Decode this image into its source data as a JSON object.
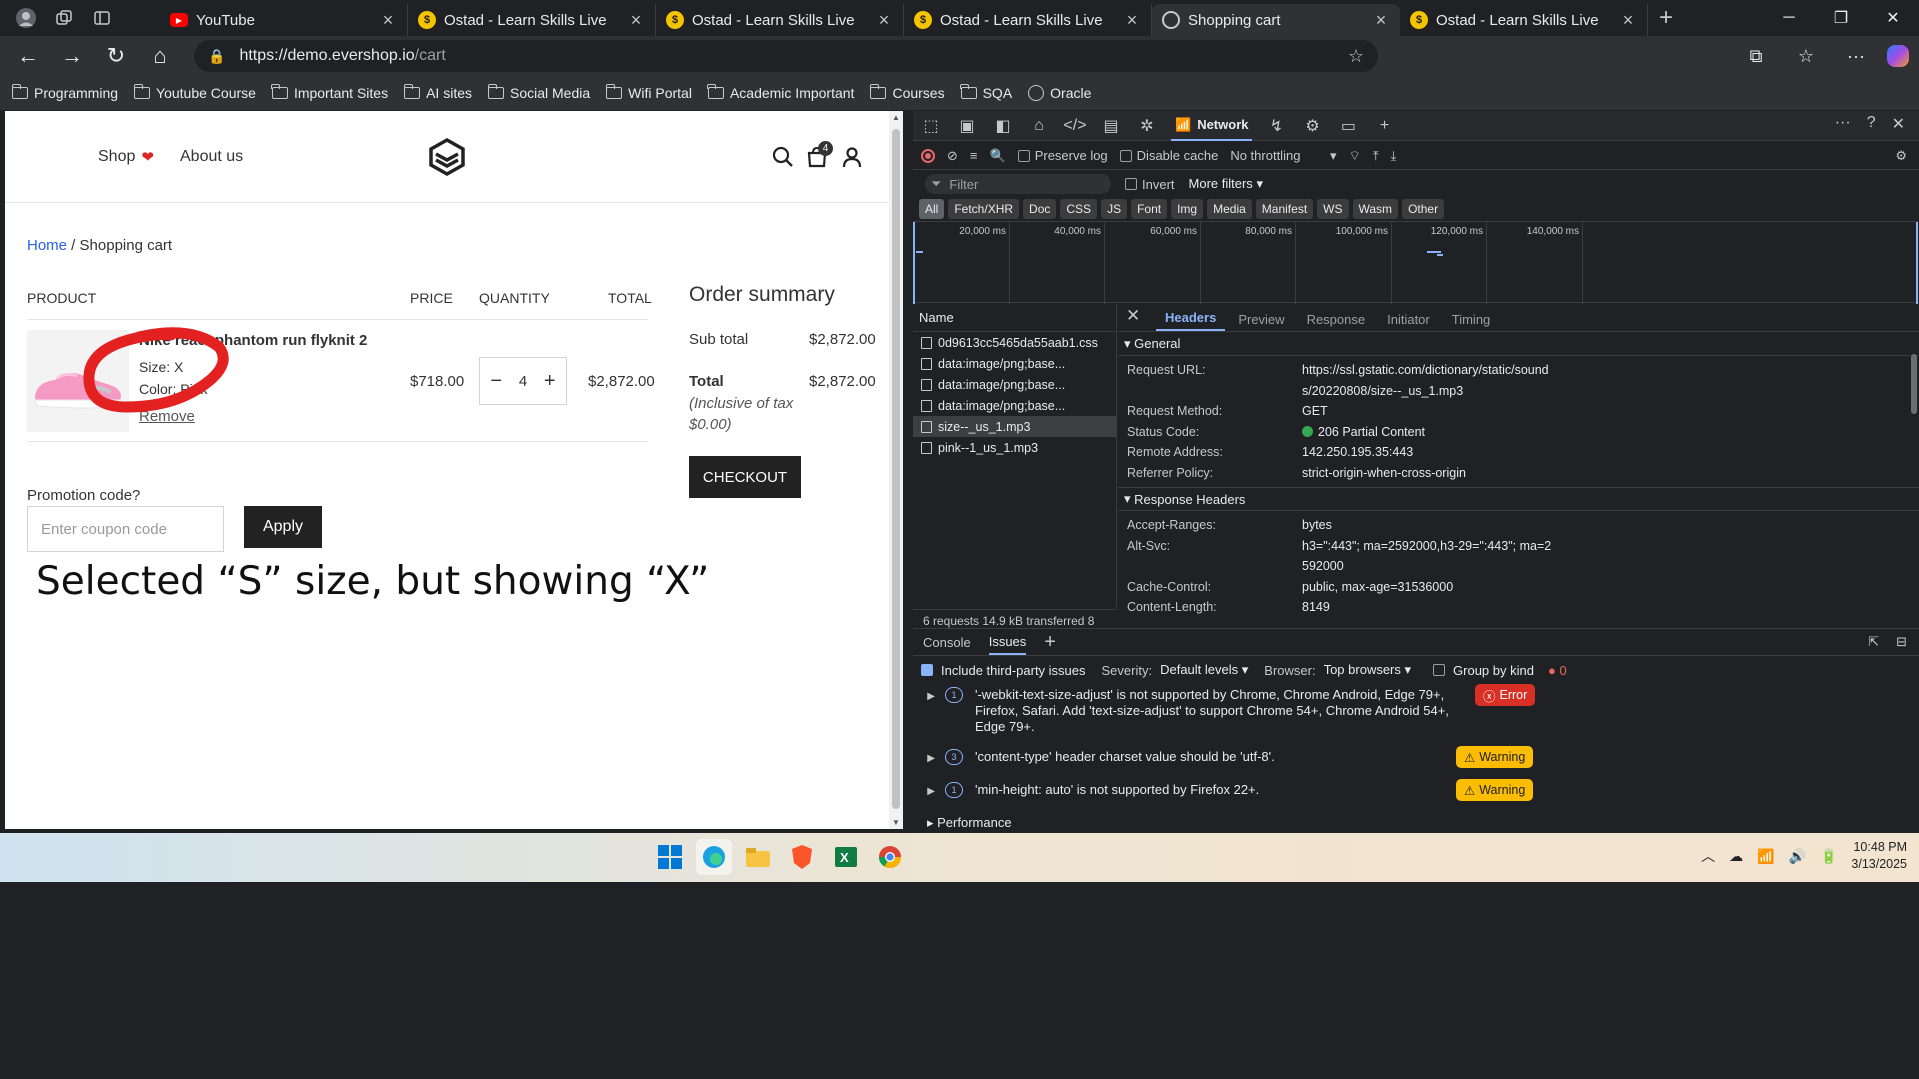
{
  "tabs": [
    {
      "title": "YouTube",
      "favicon": "youtube-icon",
      "active": false
    },
    {
      "title": "Ostad - Learn Skills Live",
      "favicon": "ostad-icon",
      "active": false
    },
    {
      "title": "Ostad - Learn Skills Live",
      "favicon": "ostad-icon",
      "active": false
    },
    {
      "title": "Ostad - Learn Skills Live",
      "favicon": "ostad-icon",
      "active": false
    },
    {
      "title": "Shopping cart",
      "favicon": "globe-icon",
      "active": true
    },
    {
      "title": "Ostad - Learn Skills Live",
      "favicon": "ostad-icon",
      "active": false
    }
  ],
  "address": {
    "host": "https://demo.evershop.io",
    "path": "/cart"
  },
  "bookmarks": [
    "Programming",
    "Youtube Course",
    "Important Sites",
    "AI sites",
    "Social Media",
    "Wifi Portal",
    "Academic Important",
    "Courses",
    "SQA",
    "Oracle"
  ],
  "site": {
    "nav": {
      "shop": "Shop",
      "about": "About us"
    },
    "cart_count": "4",
    "breadcrumb": {
      "home": "Home",
      "sep": " / ",
      "current": "Shopping cart"
    },
    "table_headers": {
      "product": "PRODUCT",
      "price": "PRICE",
      "quantity": "QUANTITY",
      "total": "TOTAL"
    },
    "item": {
      "name": "Nike react phantom run flyknit 2",
      "size": "Size: X",
      "color": "Color: Pink",
      "remove": "Remove",
      "price": "$718.00",
      "quantity": "4",
      "minus": "−",
      "plus": "+",
      "total": "$2,872.00"
    },
    "summary": {
      "title": "Order summary",
      "subtotal_label": "Sub total",
      "subtotal_value": "$2,872.00",
      "total_label": "Total",
      "total_value": "$2,872.00",
      "tax_note": "(Inclusive of tax $0.00)",
      "checkout": "CHECKOUT"
    },
    "promo": {
      "label": "Promotion code?",
      "placeholder": "Enter coupon code",
      "apply": "Apply"
    },
    "annotation": "Selected “S” size, but showing “X”"
  },
  "devtools": {
    "active_panel": "Network",
    "toolbar": {
      "preserve_log": "Preserve log",
      "disable_cache": "Disable cache",
      "throttling": "No throttling"
    },
    "filter": {
      "placeholder": "Filter",
      "invert": "Invert",
      "more_filters": "More filters"
    },
    "type_filters": [
      "All",
      "Fetch/XHR",
      "Doc",
      "CSS",
      "JS",
      "Font",
      "Img",
      "Media",
      "Manifest",
      "WS",
      "Wasm",
      "Other"
    ],
    "timeline_ticks": [
      "20,000 ms",
      "40,000 ms",
      "60,000 ms",
      "80,000 ms",
      "100,000 ms",
      "120,000 ms",
      "140,000 ms"
    ],
    "requests_header": "Name",
    "requests": [
      "0d9613cc5465da55aab1.css",
      "data:image/png;base...",
      "data:image/png;base...",
      "data:image/png;base...",
      "size--_us_1.mp3",
      "pink--1_us_1.mp3"
    ],
    "selected_request": 4,
    "footer": "6 requests   14.9 kB transferred   8",
    "detail_tabs": [
      "Headers",
      "Preview",
      "Response",
      "Initiator",
      "Timing"
    ],
    "general_title": "General",
    "general": [
      {
        "k": "Request URL:",
        "v": "https://ssl.gstatic.com/dictionary/static/sounds/20220808/size--_us_1.mp3"
      },
      {
        "k": "Request Method:",
        "v": "GET"
      },
      {
        "k": "Status Code:",
        "v": "206 Partial Content"
      },
      {
        "k": "Remote Address:",
        "v": "142.250.195.35:443"
      },
      {
        "k": "Referrer Policy:",
        "v": "strict-origin-when-cross-origin"
      }
    ],
    "response_title": "Response Headers",
    "response_headers": [
      {
        "k": "Accept-Ranges:",
        "v": "bytes"
      },
      {
        "k": "Alt-Svc:",
        "v": "h3=\":443\"; ma=2592000,h3-29=\":443\"; ma=2592000"
      },
      {
        "k": "Cache-Control:",
        "v": "public, max-age=31536000"
      },
      {
        "k": "Content-Length:",
        "v": "8149"
      }
    ],
    "drawer_tabs": [
      "Console",
      "Issues"
    ],
    "issues_bar": {
      "third_party": "Include third-party issues",
      "severity": "Severity:",
      "levels": "Default levels",
      "browser": "Browser:",
      "browsers": "Top browsers",
      "group": "Group by kind",
      "count": "0"
    },
    "issues": [
      {
        "count": "1",
        "text": "'-webkit-text-size-adjust' is not supported by Chrome, Chrome Android, Edge 79+, Firefox, Safari. Add 'text-size-adjust' to support Chrome 54+, Chrome Android 54+, Edge 79+.",
        "badge": "Error"
      },
      {
        "count": "3",
        "text": "'content-type' header charset value should be 'utf-8'.",
        "badge": "Warning"
      },
      {
        "count": "1",
        "text": "'min-height: auto' is not supported by Firefox 22+.",
        "badge": "Warning"
      }
    ],
    "perf": "Performance"
  },
  "taskbar": {
    "time": "10:48 PM",
    "date": "3/13/2025"
  }
}
